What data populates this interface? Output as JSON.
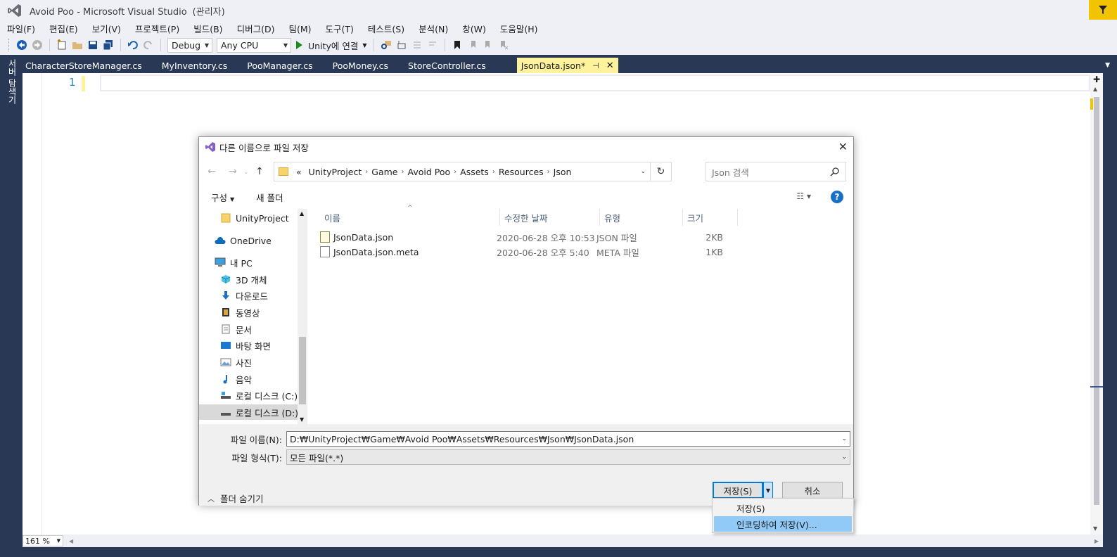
{
  "window": {
    "title": "Avoid Poo - Microsoft Visual Studio",
    "admin": "(관리자)"
  },
  "menu": [
    "파일(F)",
    "편집(E)",
    "보기(V)",
    "프로젝트(P)",
    "빌드(B)",
    "디버그(D)",
    "팀(M)",
    "도구(T)",
    "테스트(S)",
    "분석(N)",
    "창(W)",
    "도움말(H)"
  ],
  "toolbar": {
    "config": "Debug",
    "platform": "Any CPU",
    "run_label": "Unity에 연결"
  },
  "side_panel": {
    "label": "서버 탐색기"
  },
  "tabs": [
    {
      "label": "CharacterStoreManager.cs"
    },
    {
      "label": "MyInventory.cs"
    },
    {
      "label": "PooManager.cs"
    },
    {
      "label": "PooMoney.cs"
    },
    {
      "label": "StoreController.cs"
    },
    {
      "label": "JsonData.json*",
      "active": true
    }
  ],
  "editor": {
    "line_number": "1",
    "zoom": "161 %"
  },
  "dialog": {
    "title": "다른 이름으로 파일 저장",
    "breadcrumb_prefix": "«",
    "breadcrumb": [
      "UnityProject",
      "Game",
      "Avoid Poo",
      "Assets",
      "Resources",
      "Json"
    ],
    "search_placeholder": "Json 검색",
    "commands": {
      "organize": "구성",
      "new_folder": "새 폴더"
    },
    "nav": [
      {
        "label": "UnityProject",
        "icon": "folder-icon"
      },
      {
        "label": "OneDrive",
        "icon": "cloud-icon"
      },
      {
        "label": "내 PC",
        "icon": "pc-icon"
      },
      {
        "label": "3D 개체",
        "icon": "cube-icon"
      },
      {
        "label": "다운로드",
        "icon": "download-icon"
      },
      {
        "label": "동영상",
        "icon": "video-icon"
      },
      {
        "label": "문서",
        "icon": "document-icon"
      },
      {
        "label": "바탕 화면",
        "icon": "desktop-icon"
      },
      {
        "label": "사진",
        "icon": "picture-icon"
      },
      {
        "label": "음악",
        "icon": "music-icon"
      },
      {
        "label": "로컬 디스크 (C:)",
        "icon": "drive-icon"
      },
      {
        "label": "로컬 디스크 (D:)",
        "icon": "drive-icon",
        "selected": true
      }
    ],
    "columns": {
      "name": "이름",
      "modified": "수정한 날짜",
      "type": "유형",
      "size": "크기"
    },
    "files": [
      {
        "name": "JsonData.json",
        "modified": "2020-06-28 오후 10:53",
        "type": "JSON 파일",
        "size": "2KB"
      },
      {
        "name": "JsonData.json.meta",
        "modified": "2020-06-28 오후 5:40",
        "type": "META 파일",
        "size": "1KB"
      }
    ],
    "filename_label": "파일 이름(N):",
    "filename_value": "D:₩UnityProject₩Game₩Avoid Poo₩Assets₩Resources₩Json₩JsonData.json",
    "filetype_label": "파일 형식(T):",
    "filetype_value": "모든 파일(*.*)",
    "hide_folders": "폴더 숨기기",
    "save": "저장(S)",
    "cancel": "취소",
    "save_menu": [
      "저장(S)",
      "인코딩하여 저장(V)..."
    ]
  }
}
